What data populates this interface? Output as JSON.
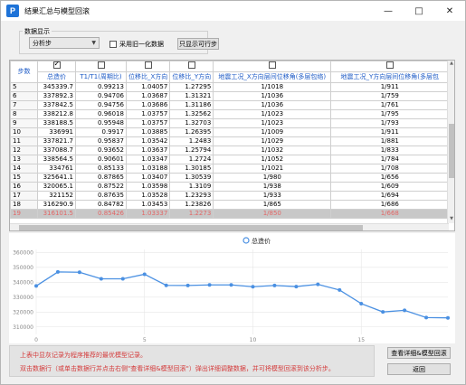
{
  "window": {
    "title": "结果汇总与模型回滚",
    "app_icon_glyph": "P"
  },
  "data_display": {
    "group_label": "数据显示",
    "select_value": "分析步",
    "legacy_label": "采用旧一化数据",
    "legacy_checked": false,
    "feasible_button": "只显示可行步"
  },
  "table": {
    "step_header": "步数",
    "columns": [
      {
        "label": "总造价",
        "checked": true
      },
      {
        "label": "T1/T1(周期比)",
        "checked": false
      },
      {
        "label": "位移比_X方向",
        "checked": false
      },
      {
        "label": "位移比_Y方向",
        "checked": false
      },
      {
        "label": "地震工况_X方向层间位移角(多层包络)",
        "checked": false
      },
      {
        "label": "地震工况_Y方向层间位移角(多层包",
        "checked": false
      }
    ],
    "rows": [
      [
        "5",
        "345339.7",
        "0.99213",
        "1.04057",
        "1.27295",
        "1/1018",
        "1/911"
      ],
      [
        "6",
        "337892.3",
        "0.94706",
        "1.03687",
        "1.31321",
        "1/1036",
        "1/759"
      ],
      [
        "7",
        "337842.5",
        "0.94756",
        "1.03686",
        "1.31186",
        "1/1036",
        "1/761"
      ],
      [
        "8",
        "338212.8",
        "0.96018",
        "1.03757",
        "1.32562",
        "1/1023",
        "1/795"
      ],
      [
        "9",
        "338188.5",
        "0.95948",
        "1.03757",
        "1.32703",
        "1/1023",
        "1/793"
      ],
      [
        "10",
        "336991",
        "0.9917",
        "1.03885",
        "1.26395",
        "1/1009",
        "1/911"
      ],
      [
        "11",
        "337821.7",
        "0.95837",
        "1.03542",
        "1.2483",
        "1/1029",
        "1/881"
      ],
      [
        "12",
        "337088.7",
        "0.93652",
        "1.03637",
        "1.25794",
        "1/1032",
        "1/833"
      ],
      [
        "13",
        "338564.5",
        "0.90601",
        "1.03347",
        "1.2724",
        "1/1052",
        "1/784"
      ],
      [
        "14",
        "334761",
        "0.85133",
        "1.03188",
        "1.30185",
        "1/1021",
        "1/708"
      ],
      [
        "15",
        "325641.1",
        "0.87865",
        "1.03407",
        "1.30539",
        "1/980",
        "1/656"
      ],
      [
        "16",
        "320065.1",
        "0.87522",
        "1.03598",
        "1.3109",
        "1/938",
        "1/609"
      ],
      [
        "17",
        "321152",
        "0.87635",
        "1.03528",
        "1.23293",
        "1/933",
        "1/694"
      ],
      [
        "18",
        "316290.9",
        "0.84782",
        "1.03453",
        "1.23826",
        "1/865",
        "1/686"
      ],
      [
        "19",
        "316101.5",
        "0.85426",
        "1.03337",
        "1.2273",
        "1/850",
        "1/668"
      ]
    ],
    "highlight_row_index": 14
  },
  "chart_data": {
    "type": "line",
    "legend": "总造价",
    "y_ticks": [
      "360000",
      "350000",
      "340000",
      "330000",
      "320000",
      "310000"
    ],
    "x_ticks": [
      "0",
      "5",
      "10",
      "15"
    ],
    "ylim": [
      305000,
      362000
    ],
    "xlim": [
      0,
      19
    ],
    "x": [
      0,
      1,
      2,
      3,
      4,
      5,
      6,
      7,
      8,
      9,
      10,
      11,
      12,
      13,
      14,
      15,
      16,
      17,
      18,
      19
    ],
    "values": [
      337500,
      346900,
      346700,
      342300,
      342300,
      345339.7,
      337892.3,
      337842.5,
      338212.8,
      338188.5,
      336991,
      337821.7,
      337088.7,
      338564.5,
      334761,
      325641.1,
      320065.1,
      321152,
      316290.9,
      316101.5
    ],
    "line_color": "#4a90e2"
  },
  "notes": {
    "line1": "上表中显灰记录为程序推荐的最优模型记录。",
    "line2": "双击数据行（或单击数据行并点击右侧\"查看详细&模型回滚\"）弹出详细调整数据，并可将模型回滚到该分析步。"
  },
  "buttons": {
    "view": "查看详细&模型回滚",
    "back": "返回"
  }
}
